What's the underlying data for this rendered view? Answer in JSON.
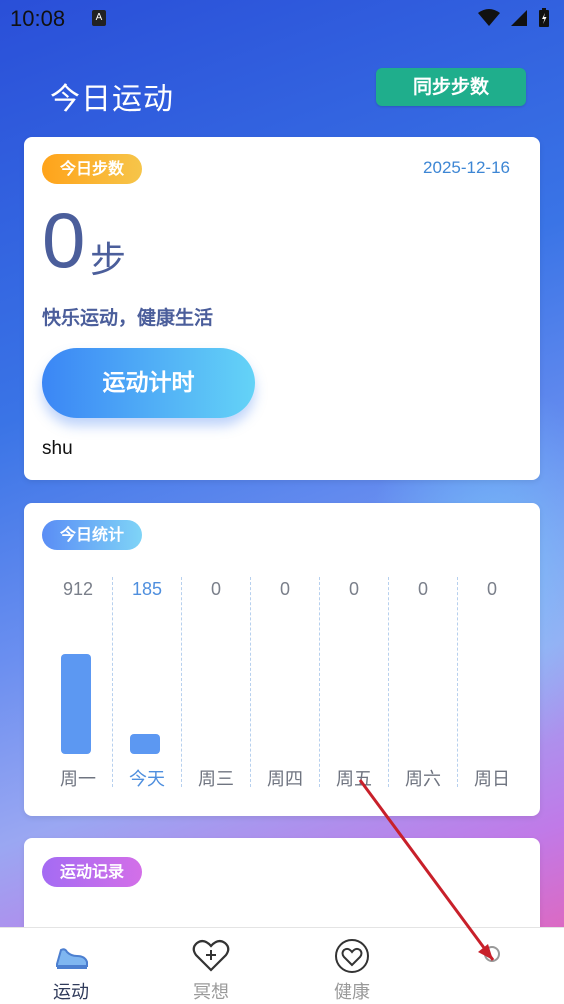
{
  "status": {
    "time": "10:08",
    "notif_letter": "A"
  },
  "header": {
    "title": "今日运动",
    "sync_label": "同步步数"
  },
  "today_card": {
    "pill": "今日步数",
    "date": "2025-12-16",
    "steps": "0",
    "unit": "步",
    "slogan": "快乐运动，健康生活",
    "timer_button": "运动计时",
    "user": "shu"
  },
  "stats_card": {
    "pill": "今日统计",
    "days": [
      {
        "label": "周一",
        "value": "912",
        "active": false
      },
      {
        "label": "今天",
        "value": "185",
        "active": true
      },
      {
        "label": "周三",
        "value": "0",
        "active": false
      },
      {
        "label": "周四",
        "value": "0",
        "active": false
      },
      {
        "label": "周五",
        "value": "0",
        "active": false
      },
      {
        "label": "周六",
        "value": "0",
        "active": false
      },
      {
        "label": "周日",
        "value": "0",
        "active": false
      }
    ]
  },
  "chart_data": {
    "type": "bar",
    "categories": [
      "周一",
      "今天",
      "周三",
      "周四",
      "周五",
      "周六",
      "周日"
    ],
    "values": [
      912,
      185,
      0,
      0,
      0,
      0,
      0
    ]
  },
  "record_card": {
    "pill": "运动记录"
  },
  "tabbar": {
    "items": [
      {
        "label": "运动",
        "icon": "shoe-icon",
        "active": true
      },
      {
        "label": "冥想",
        "icon": "heart-plus-icon",
        "active": false
      },
      {
        "label": "健康",
        "icon": "heart-icon",
        "active": false
      },
      {
        "label": "",
        "icon": "profile-icon",
        "active": false
      }
    ]
  },
  "colors": {
    "accent_blue": "#3d86d4",
    "sync_green": "#1fae8c",
    "bar_blue": "#5c98f2",
    "text_navy": "#4b5e9b"
  }
}
